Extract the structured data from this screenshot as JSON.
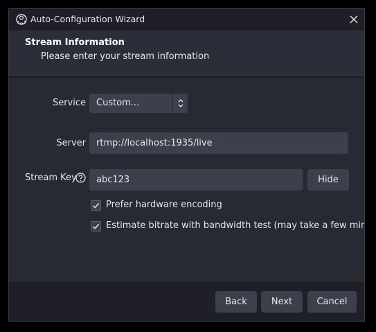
{
  "window": {
    "title": "Auto-Configuration Wizard"
  },
  "header": {
    "title": "Stream Information",
    "subtitle": "Please enter your stream information"
  },
  "form": {
    "service_label": "Service",
    "service_value": "Custom...",
    "server_label": "Server",
    "server_value": "rtmp://localhost:1935/live",
    "stream_key_label": "Stream Key",
    "stream_key_value": "abc123",
    "hide_button": "Hide",
    "prefer_hardware_label": "Prefer hardware encoding",
    "prefer_hardware_checked": true,
    "bandwidth_test_label": "Estimate bitrate with bandwidth test (may take a few minut",
    "bandwidth_test_checked": true
  },
  "footer": {
    "back": "Back",
    "next": "Next",
    "cancel": "Cancel"
  },
  "colors": {
    "window_bg": "#1e1f27",
    "header_bg": "#2b2e38",
    "content_bg": "#272a33",
    "control_bg": "#3c404d",
    "text": "#e6e6e6"
  },
  "icons": {
    "app": "obs-logo-icon",
    "close": "close-icon",
    "select_arrows": "up-down-chevron-icon",
    "help": "question-circle-icon",
    "check": "checkmark-icon"
  }
}
